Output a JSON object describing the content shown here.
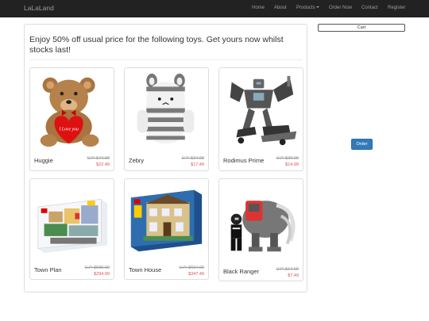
{
  "nav": {
    "brand": "LaLaLand",
    "items": [
      "Home",
      "About",
      "Products",
      "Order Now",
      "Contact",
      "Register"
    ]
  },
  "headline": "Enjoy 50% off usual price for the following toys. Get yours now whilst stocks last!",
  "products": [
    {
      "name": "Huggie",
      "old_price": "U.P. $44.99",
      "price": "$22.49",
      "icon": "teddy-bear"
    },
    {
      "name": "Zebry",
      "old_price": "U.P. $34.99",
      "price": "$17.49",
      "icon": "zebra-plush"
    },
    {
      "name": "Rodimus Prime",
      "old_price": "U.P. $29.99",
      "price": "$14.99",
      "icon": "robot-figure"
    },
    {
      "name": "Town Plan",
      "old_price": "U.P. $589.99",
      "price": "$294.99",
      "icon": "lego-box"
    },
    {
      "name": "Town House",
      "old_price": "U.P. $694.99",
      "price": "$347.49",
      "icon": "lego-house-box"
    },
    {
      "name": "Black Ranger",
      "old_price": "U.P. $14.99",
      "price": "$7.49",
      "icon": "mastodon-zord"
    }
  ],
  "sidebar": {
    "cart_label": "Cart",
    "order_label": "Order"
  }
}
